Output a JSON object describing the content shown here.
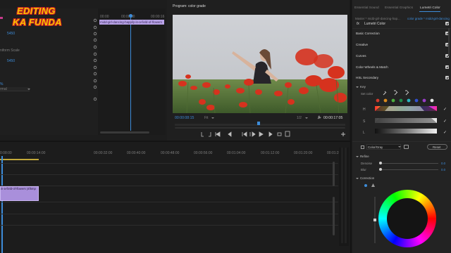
{
  "logo": {
    "line1": "EDITING",
    "line2": "KA FUNDA"
  },
  "effect_controls": {
    "values": [
      "5450",
      "5450"
    ],
    "label_uniform_scale": "niform Scale",
    "percent": "%",
    "blend_mode": "rmal"
  },
  "source_timeline": {
    "times": [
      "00:00",
      "00:00:00",
      "00:00:16"
    ],
    "clip_label": "midd-girl-dancing-happily-in-a-field-of-flowers"
  },
  "program": {
    "title": "Program: color grade",
    "timecode": "00:00:08:15",
    "fit": "Fit",
    "resolution": "1/2",
    "duration": "00:00:17:05"
  },
  "timeline": {
    "ruler": [
      "0:08:00",
      "00:00:14:00",
      "00:00:32:00",
      "00:00:40:00",
      "00:00:48:00",
      "00:00:56:00",
      "00:01:04:00",
      "00:01:12:00",
      "00:01:20:00",
      "00:01:28:00"
    ],
    "clip_label": "in-a-field-of-flowers (4f5mp"
  },
  "tabs": [
    "Essential Sound",
    "Essential Graphics",
    "Lumetri Color"
  ],
  "lumetri": {
    "master": "Master * midd-girl-dancing-hap...",
    "sequence": "color grade * midd-girl-dancing-...",
    "fx_label": "fx",
    "effect_name": "Lumetri Color",
    "sections": [
      "Basic Correction",
      "Creative",
      "Curves",
      "Color Wheels & Match",
      "HSL Secondary"
    ],
    "key_label": "Key",
    "set_color": "Set color",
    "h_label": "H",
    "s_label": "S",
    "l_label": "L",
    "gray_mode": "Color/Gray",
    "reset": "Reset",
    "refine": "Refine",
    "denoise": "Denoise",
    "denoise_value": "0.0",
    "blur": "Blur",
    "blur_value": "0.0",
    "correction": "Correction"
  },
  "colors": {
    "accent": "#3d8cd9",
    "clip_purple": "#a98fdb",
    "clip_label_bg": "#b9a3e8",
    "playhead": "#3d8cd9",
    "logo_yellow": "#f7c500",
    "logo_red": "#c81d25"
  }
}
